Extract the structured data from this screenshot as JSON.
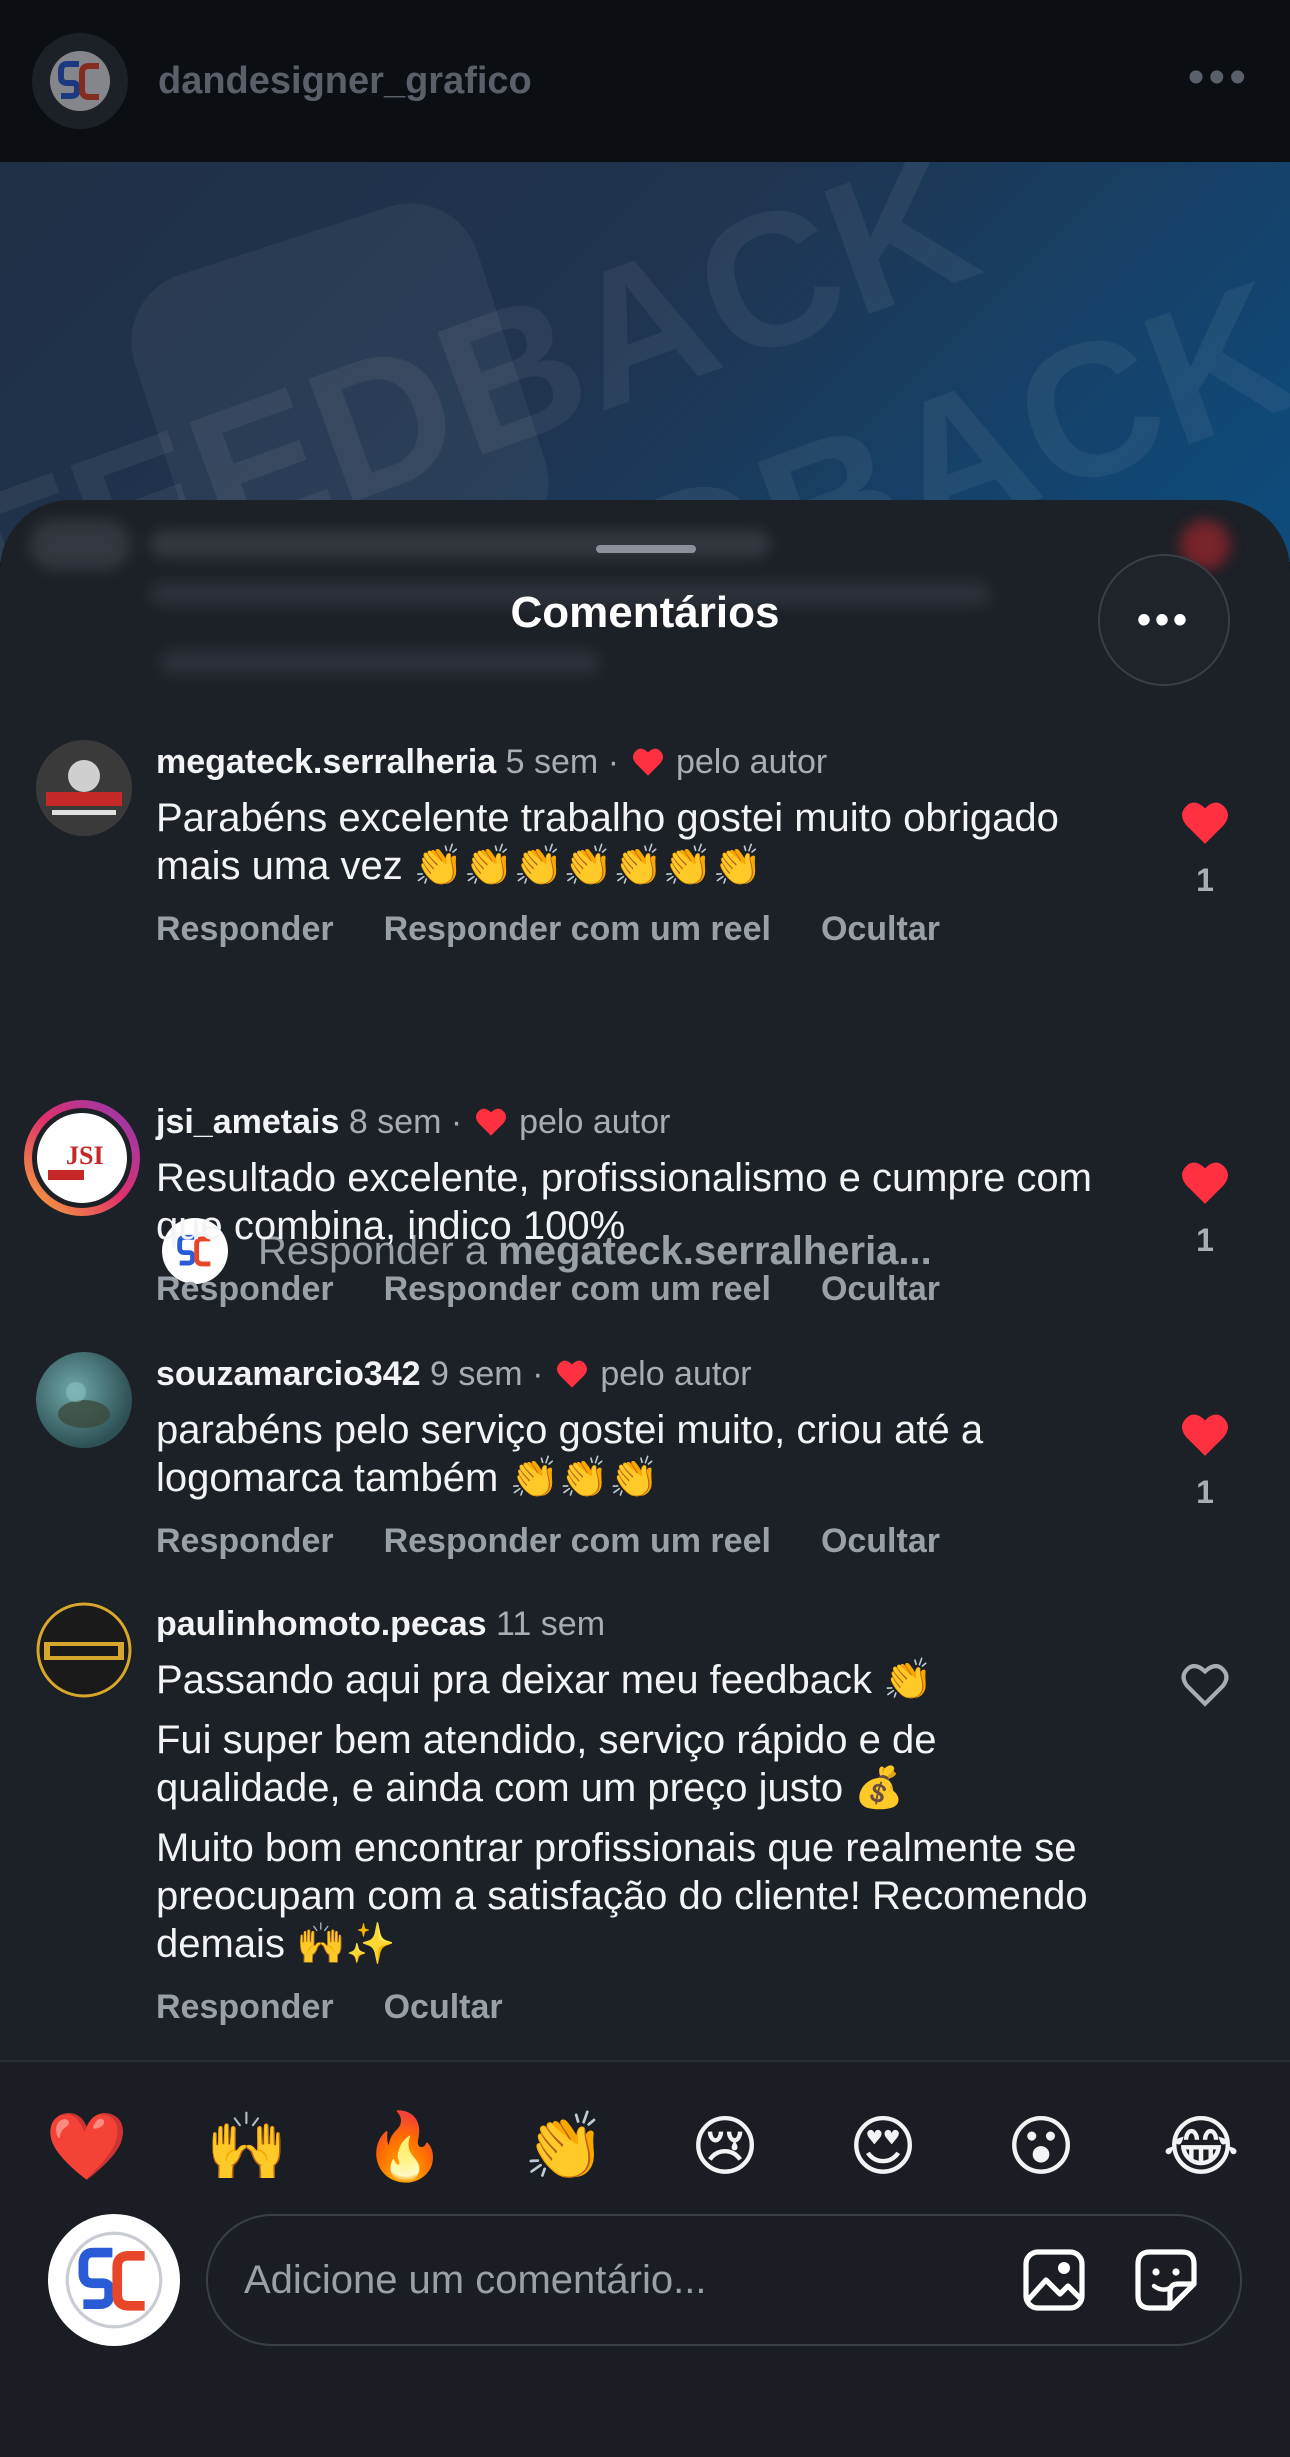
{
  "post": {
    "username": "dandesigner_grafico",
    "media_text": [
      "FEEDBACK",
      "FEEDBACK"
    ]
  },
  "sheet": {
    "title": "Comentários",
    "more_icon": "more-horizontal-icon"
  },
  "comments": [
    {
      "username": "megateck.serralheria",
      "time": "5 sem",
      "separator": "·",
      "liked_by_author": "pelo autor",
      "text": [
        "Parabéns excelente trabalho gostei muito obrigado mais uma vez 👏👏👏👏👏👏👏"
      ],
      "actions": [
        "Responder",
        "Responder com um reel",
        "Ocultar"
      ],
      "likes": "1",
      "liked": true
    },
    {
      "username": "jsi_ametais",
      "time": "8 sem",
      "separator": "·",
      "liked_by_author": "pelo autor",
      "text": [
        "Resultado excelente, profissionalismo e cumpre com que combina, indico 100%"
      ],
      "actions": [
        "Responder",
        "Responder com um reel",
        "Ocultar"
      ],
      "likes": "1",
      "liked": true
    },
    {
      "username": "souzamarcio342",
      "time": "9 sem",
      "separator": "·",
      "liked_by_author": "pelo autor",
      "text": [
        "parabéns pelo serviço gostei muito, criou até a logomarca também 👏👏👏"
      ],
      "actions": [
        "Responder",
        "Responder com um reel",
        "Ocultar"
      ],
      "likes": "1",
      "liked": true
    },
    {
      "username": "paulinhomoto.pecas",
      "time": "11 sem",
      "text": [
        "Passando aqui pra deixar meu feedback 👏",
        "Fui super bem atendido, serviço rápido e de qualidade, e ainda com um preço justo 💰",
        "Muito bom encontrar profissionais que realmente se preocupam com a satisfação do cliente! Recomendo demais 🙌✨"
      ],
      "actions": [
        "Responder",
        "Ocultar"
      ],
      "liked": false
    }
  ],
  "reply_prompt": {
    "prefix": "Responder a",
    "target": "megateck.serralheria..."
  },
  "emoji_bar": [
    "❤️",
    "🙌",
    "🔥",
    "👏",
    "😢",
    "😍",
    "😮",
    "😂"
  ],
  "composer": {
    "placeholder": "Adicione um comentário...",
    "icons": [
      "image-icon",
      "sticker-icon"
    ]
  },
  "colors": {
    "background": "#1c2027",
    "like_red": "#ff3040",
    "muted_text": "#9aa0a8"
  }
}
